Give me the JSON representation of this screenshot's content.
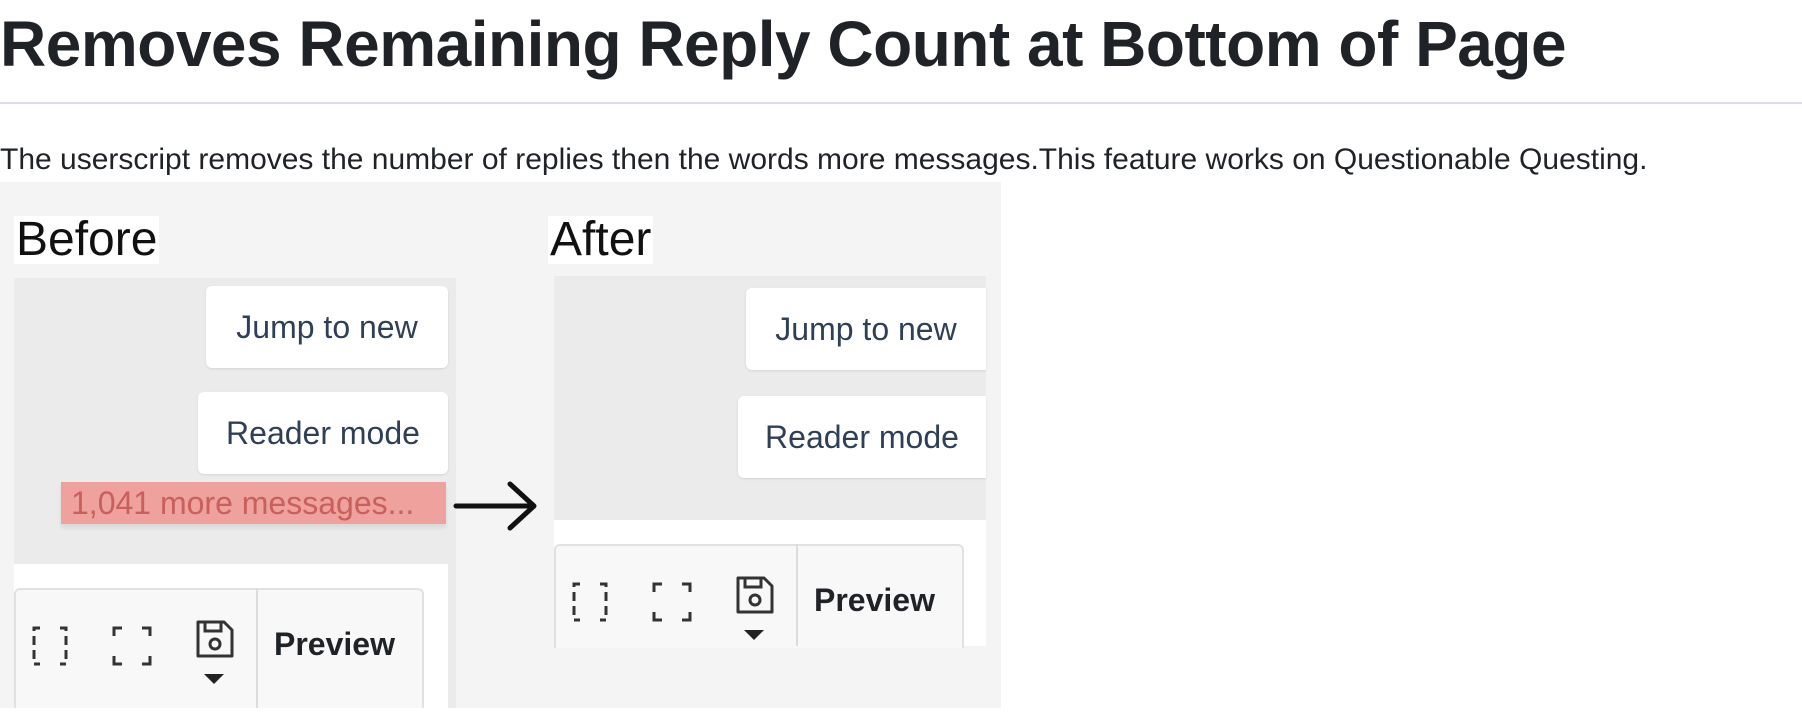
{
  "heading": "Removes Remaining Reply Count at Bottom of Page",
  "description": "The userscript removes the number of replies then the words more messages.This feature works on Questionable Questing.",
  "screenshot": {
    "before": {
      "caption": "Before",
      "jump_button": "Jump to new",
      "reader_button": "Reader mode",
      "more_messages": "1,041 more messages...",
      "preview_label": "Preview"
    },
    "after": {
      "caption": "After",
      "jump_button": "Jump to new",
      "reader_button": "Reader mode",
      "preview_label": "Preview"
    },
    "highlight_color": "#eea19d",
    "icons": [
      "brackets-icon",
      "fullscreen-icon",
      "save-draft-icon",
      "dropdown-caret-icon",
      "arrow-right-icon"
    ]
  }
}
